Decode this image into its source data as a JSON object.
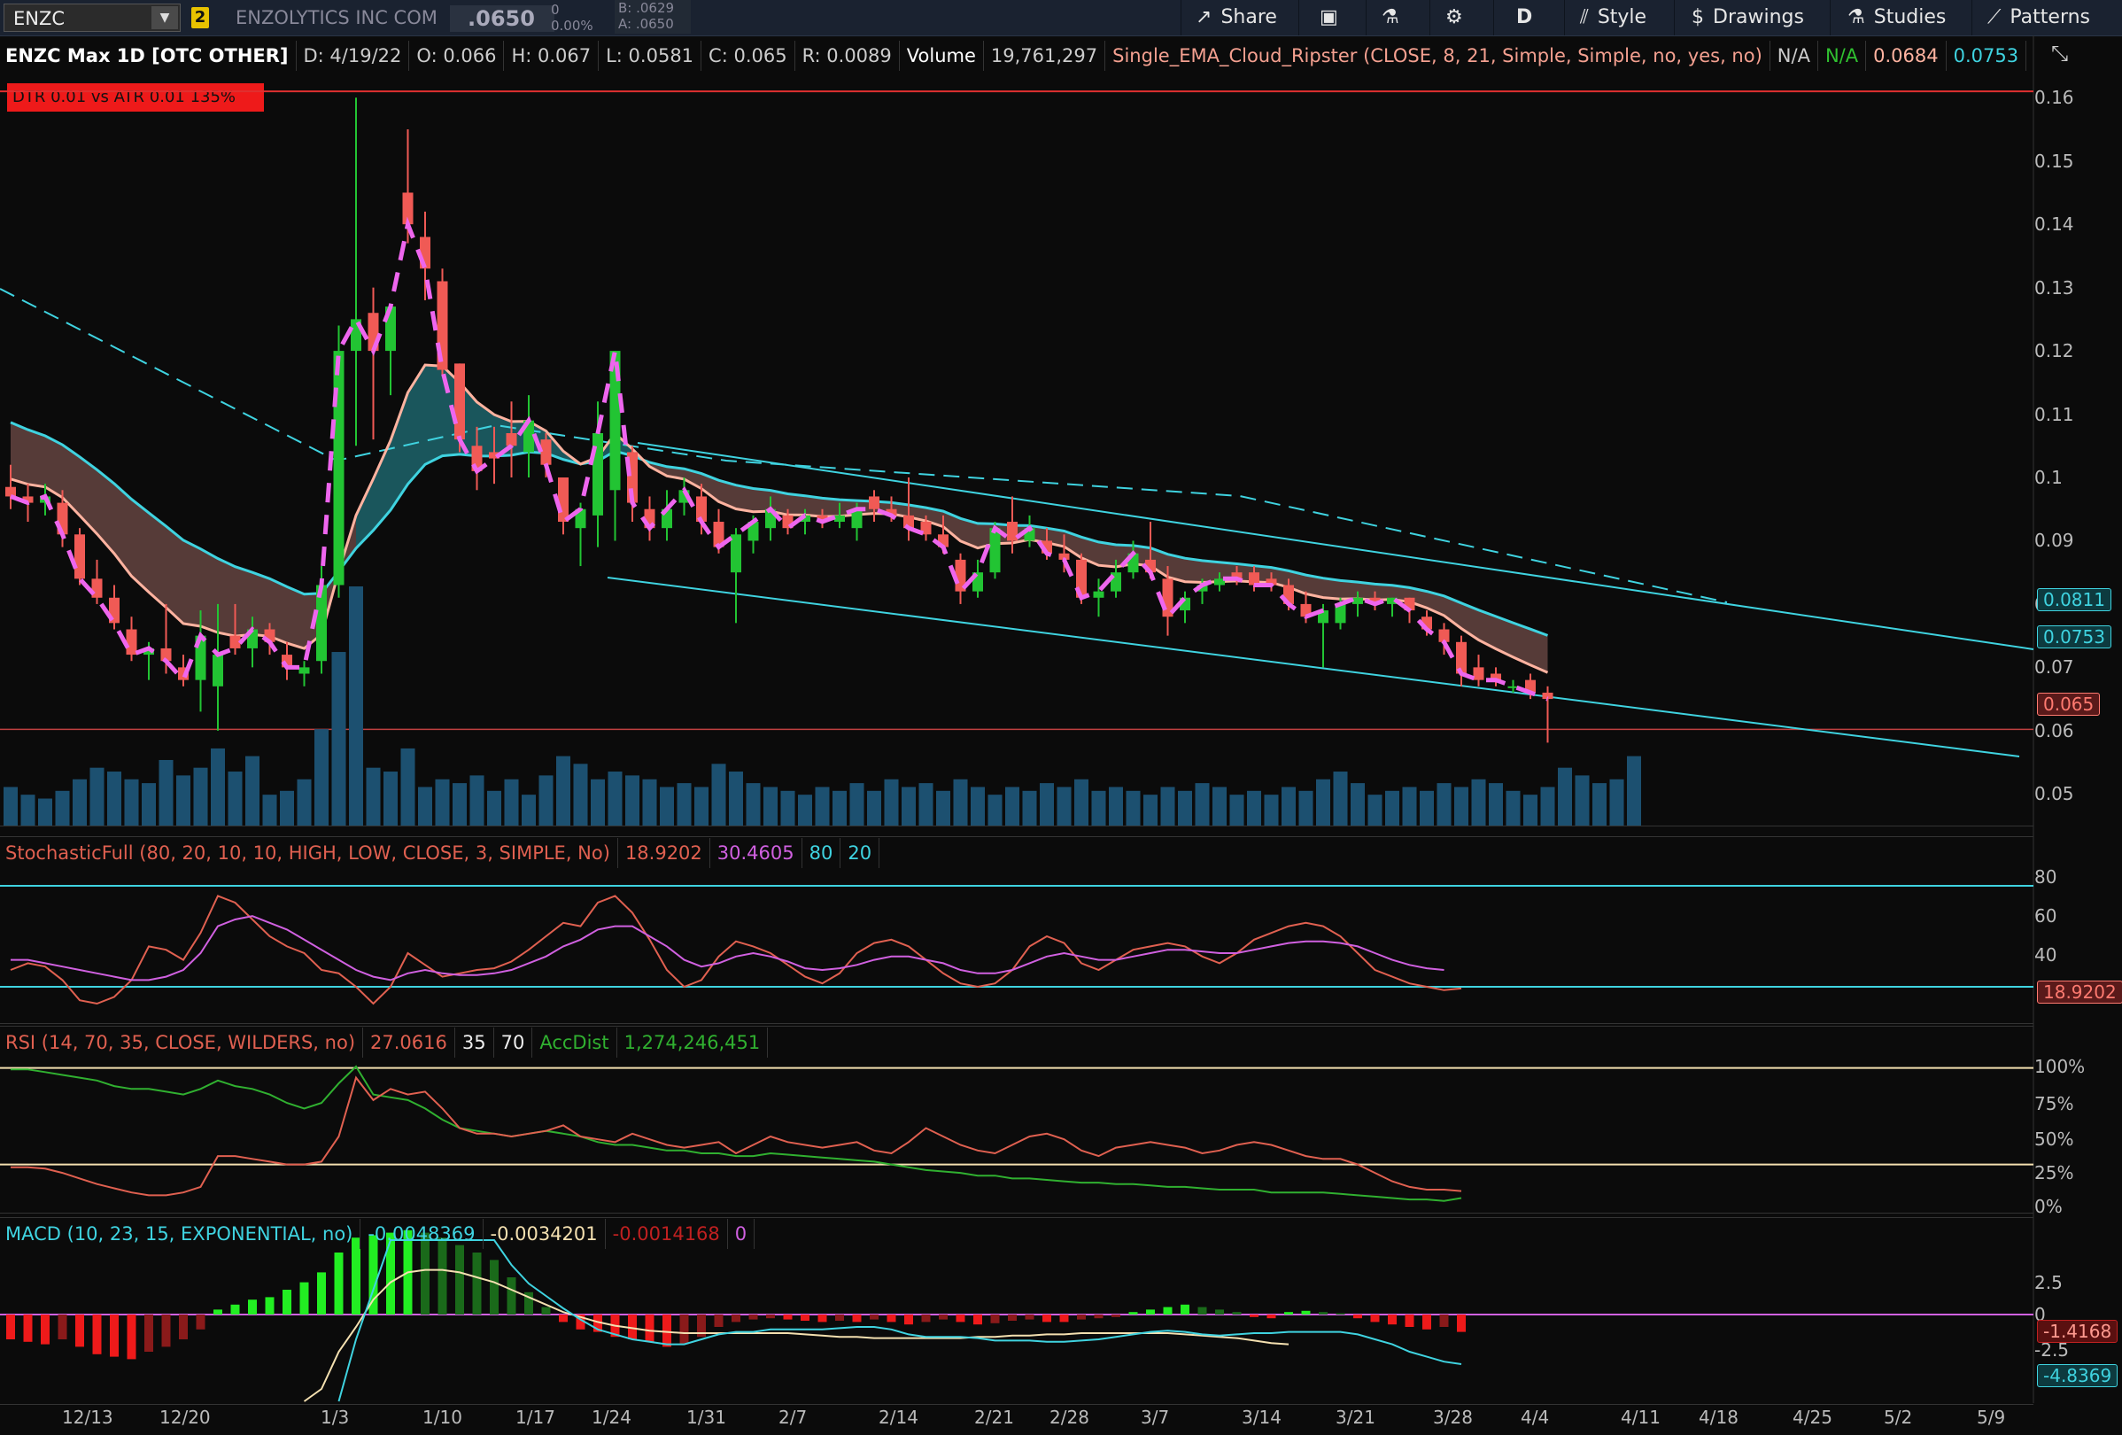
{
  "toolbar": {
    "symbol": "ENZC",
    "link_badge": "2",
    "company": "ENZOLYTICS INC COM",
    "last": ".0650",
    "net_change": "0",
    "pct_change": "0.00%",
    "bid": "B: .0629",
    "ask": "A: .0650",
    "share_label": "Share",
    "period_label": "D",
    "style_label": "Style",
    "drawings_label": "Drawings",
    "studies_label": "Studies",
    "patterns_label": "Patterns"
  },
  "price_header": {
    "title": "ENZC Max 1D [OTC OTHER]",
    "date": "D: 4/19/22",
    "open": "O: 0.066",
    "high": "H: 0.067",
    "low": "L: 0.0581",
    "close": "C: 0.065",
    "range": "R: 0.0089",
    "volume_label": "Volume",
    "volume_value": "19,761,297",
    "study": "Single_EMA_Cloud_Ripster (CLOSE, 8, 21, Simple, Simple, no, yes, no)",
    "v1": "N/A",
    "v2": "N/A",
    "v3": "0.0684",
    "v4": "0.0753",
    "dtr": "DTR 0.01 vs ATR 0.01  135%"
  },
  "price_axis": {
    "ticks": [
      "0.16",
      "0.15",
      "0.14",
      "0.13",
      "0.12",
      "0.11",
      "0.1",
      "0.09",
      "0.08",
      "0.07",
      "0.06",
      "0.05"
    ],
    "labels": {
      "ema_fast": "0.0811",
      "ema_slow": "0.0753",
      "last": "0.065"
    }
  },
  "stoch": {
    "header": "StochasticFull (80, 20, 10, 10, HIGH, LOW, CLOSE, 3, SIMPLE, No)",
    "k": "18.9202",
    "d": "30.4605",
    "ob": "80",
    "os": "20",
    "ticks": [
      "80",
      "60",
      "40"
    ],
    "last_label": "18.9202"
  },
  "rsi": {
    "header": "RSI (14, 70, 35, CLOSE, WILDERS, no)",
    "value": "27.0616",
    "os": "35",
    "ob": "70",
    "acc_label": "AccDist",
    "acc_value": "1,274,246,451",
    "ticks": [
      "100%",
      "75%",
      "50%",
      "25%",
      "0%"
    ]
  },
  "macd": {
    "header": "MACD (10, 23, 15, EXPONENTIAL, no)",
    "value": "-0.0048369",
    "avg": "-0.0034201",
    "diff": "-0.0014168",
    "zero": "0",
    "ticks": [
      "2.5",
      "0",
      "-2.5"
    ],
    "label_diff": "-1.4168",
    "label_value": "-4.8369"
  },
  "x_axis": [
    "12/13",
    "12/20",
    "1/3",
    "1/10",
    "1/17",
    "1/24",
    "1/31",
    "2/7",
    "2/14",
    "2/21",
    "2/28",
    "3/7",
    "3/14",
    "3/21",
    "3/28",
    "4/4",
    "4/11",
    "4/18",
    "4/25",
    "5/2",
    "5/9"
  ],
  "colors": {
    "up": "#22c433",
    "down": "#f05a55",
    "ema_fast": "#ffb3a0",
    "ema_slow": "#3fd3e0",
    "signal": "#ee66ee",
    "volume": "#1c5070",
    "stoch_k": "#e06050",
    "stoch_d": "#d060e0",
    "rsi": "#e06050",
    "accdist": "#30b030",
    "macd_line": "#3fd3e0",
    "macd_avg": "#f4e0b0"
  },
  "chart_data": {
    "type": "candlestick",
    "title": "ENZC Max 1D [OTC OTHER]",
    "price_range": [
      0.045,
      0.162
    ],
    "candles": [
      {
        "o": 0.0985,
        "h": 0.102,
        "l": 0.095,
        "c": 0.097
      },
      {
        "o": 0.097,
        "h": 0.099,
        "l": 0.093,
        "c": 0.096
      },
      {
        "o": 0.096,
        "h": 0.099,
        "l": 0.094,
        "c": 0.097
      },
      {
        "o": 0.096,
        "h": 0.098,
        "l": 0.089,
        "c": 0.091
      },
      {
        "o": 0.091,
        "h": 0.092,
        "l": 0.083,
        "c": 0.084
      },
      {
        "o": 0.084,
        "h": 0.087,
        "l": 0.08,
        "c": 0.081
      },
      {
        "o": 0.081,
        "h": 0.083,
        "l": 0.076,
        "c": 0.077
      },
      {
        "o": 0.076,
        "h": 0.078,
        "l": 0.071,
        "c": 0.072
      },
      {
        "o": 0.072,
        "h": 0.074,
        "l": 0.068,
        "c": 0.073
      },
      {
        "o": 0.073,
        "h": 0.08,
        "l": 0.069,
        "c": 0.071
      },
      {
        "o": 0.07,
        "h": 0.072,
        "l": 0.067,
        "c": 0.068
      },
      {
        "o": 0.068,
        "h": 0.079,
        "l": 0.063,
        "c": 0.075
      },
      {
        "o": 0.067,
        "h": 0.08,
        "l": 0.06,
        "c": 0.072
      },
      {
        "o": 0.075,
        "h": 0.08,
        "l": 0.072,
        "c": 0.073
      },
      {
        "o": 0.073,
        "h": 0.078,
        "l": 0.07,
        "c": 0.076
      },
      {
        "o": 0.076,
        "h": 0.077,
        "l": 0.072,
        "c": 0.074
      },
      {
        "o": 0.072,
        "h": 0.074,
        "l": 0.068,
        "c": 0.07
      },
      {
        "o": 0.069,
        "h": 0.071,
        "l": 0.067,
        "c": 0.07
      },
      {
        "o": 0.071,
        "h": 0.086,
        "l": 0.069,
        "c": 0.083
      },
      {
        "o": 0.083,
        "h": 0.124,
        "l": 0.081,
        "c": 0.12
      },
      {
        "o": 0.12,
        "h": 0.16,
        "l": 0.105,
        "c": 0.125
      },
      {
        "o": 0.126,
        "h": 0.13,
        "l": 0.106,
        "c": 0.12
      },
      {
        "o": 0.12,
        "h": 0.127,
        "l": 0.113,
        "c": 0.127
      },
      {
        "o": 0.145,
        "h": 0.155,
        "l": 0.137,
        "c": 0.14
      },
      {
        "o": 0.138,
        "h": 0.142,
        "l": 0.128,
        "c": 0.133
      },
      {
        "o": 0.131,
        "h": 0.133,
        "l": 0.116,
        "c": 0.117
      },
      {
        "o": 0.118,
        "h": 0.118,
        "l": 0.104,
        "c": 0.106
      },
      {
        "o": 0.105,
        "h": 0.108,
        "l": 0.098,
        "c": 0.101
      },
      {
        "o": 0.104,
        "h": 0.108,
        "l": 0.099,
        "c": 0.103
      },
      {
        "o": 0.107,
        "h": 0.112,
        "l": 0.1,
        "c": 0.105
      },
      {
        "o": 0.104,
        "h": 0.113,
        "l": 0.1,
        "c": 0.109
      },
      {
        "o": 0.106,
        "h": 0.107,
        "l": 0.1,
        "c": 0.102
      },
      {
        "o": 0.1,
        "h": 0.1,
        "l": 0.091,
        "c": 0.093
      },
      {
        "o": 0.092,
        "h": 0.096,
        "l": 0.086,
        "c": 0.095
      },
      {
        "o": 0.094,
        "h": 0.112,
        "l": 0.089,
        "c": 0.107
      },
      {
        "o": 0.098,
        "h": 0.12,
        "l": 0.09,
        "c": 0.12
      },
      {
        "o": 0.104,
        "h": 0.105,
        "l": 0.093,
        "c": 0.096
      },
      {
        "o": 0.095,
        "h": 0.097,
        "l": 0.09,
        "c": 0.092
      },
      {
        "o": 0.092,
        "h": 0.098,
        "l": 0.09,
        "c": 0.095
      },
      {
        "o": 0.096,
        "h": 0.1,
        "l": 0.094,
        "c": 0.098
      },
      {
        "o": 0.097,
        "h": 0.099,
        "l": 0.091,
        "c": 0.093
      },
      {
        "o": 0.093,
        "h": 0.095,
        "l": 0.088,
        "c": 0.089
      },
      {
        "o": 0.085,
        "h": 0.092,
        "l": 0.077,
        "c": 0.091
      },
      {
        "o": 0.09,
        "h": 0.094,
        "l": 0.088,
        "c": 0.093
      },
      {
        "o": 0.092,
        "h": 0.097,
        "l": 0.09,
        "c": 0.095
      },
      {
        "o": 0.094,
        "h": 0.095,
        "l": 0.091,
        "c": 0.092
      },
      {
        "o": 0.093,
        "h": 0.095,
        "l": 0.091,
        "c": 0.094
      },
      {
        "o": 0.094,
        "h": 0.095,
        "l": 0.092,
        "c": 0.093
      },
      {
        "o": 0.093,
        "h": 0.096,
        "l": 0.092,
        "c": 0.094
      },
      {
        "o": 0.092,
        "h": 0.096,
        "l": 0.09,
        "c": 0.095
      },
      {
        "o": 0.097,
        "h": 0.098,
        "l": 0.093,
        "c": 0.095
      },
      {
        "o": 0.095,
        "h": 0.097,
        "l": 0.093,
        "c": 0.094
      },
      {
        "o": 0.094,
        "h": 0.1,
        "l": 0.09,
        "c": 0.092
      },
      {
        "o": 0.093,
        "h": 0.094,
        "l": 0.09,
        "c": 0.091
      },
      {
        "o": 0.091,
        "h": 0.094,
        "l": 0.088,
        "c": 0.089
      },
      {
        "o": 0.087,
        "h": 0.088,
        "l": 0.08,
        "c": 0.082
      },
      {
        "o": 0.082,
        "h": 0.087,
        "l": 0.081,
        "c": 0.085
      },
      {
        "o": 0.085,
        "h": 0.093,
        "l": 0.084,
        "c": 0.092
      },
      {
        "o": 0.093,
        "h": 0.097,
        "l": 0.088,
        "c": 0.09
      },
      {
        "o": 0.09,
        "h": 0.094,
        "l": 0.089,
        "c": 0.092
      },
      {
        "o": 0.09,
        "h": 0.092,
        "l": 0.087,
        "c": 0.088
      },
      {
        "o": 0.088,
        "h": 0.091,
        "l": 0.085,
        "c": 0.087
      },
      {
        "o": 0.087,
        "h": 0.088,
        "l": 0.08,
        "c": 0.081
      },
      {
        "o": 0.081,
        "h": 0.084,
        "l": 0.078,
        "c": 0.082
      },
      {
        "o": 0.082,
        "h": 0.087,
        "l": 0.081,
        "c": 0.085
      },
      {
        "o": 0.085,
        "h": 0.09,
        "l": 0.084,
        "c": 0.088
      },
      {
        "o": 0.087,
        "h": 0.093,
        "l": 0.084,
        "c": 0.085
      },
      {
        "o": 0.084,
        "h": 0.086,
        "l": 0.075,
        "c": 0.078
      },
      {
        "o": 0.079,
        "h": 0.082,
        "l": 0.077,
        "c": 0.081
      },
      {
        "o": 0.082,
        "h": 0.084,
        "l": 0.08,
        "c": 0.083
      },
      {
        "o": 0.083,
        "h": 0.085,
        "l": 0.082,
        "c": 0.084
      },
      {
        "o": 0.085,
        "h": 0.086,
        "l": 0.083,
        "c": 0.084
      },
      {
        "o": 0.085,
        "h": 0.086,
        "l": 0.082,
        "c": 0.083
      },
      {
        "o": 0.084,
        "h": 0.085,
        "l": 0.082,
        "c": 0.083
      },
      {
        "o": 0.083,
        "h": 0.084,
        "l": 0.079,
        "c": 0.08
      },
      {
        "o": 0.08,
        "h": 0.082,
        "l": 0.077,
        "c": 0.078
      },
      {
        "o": 0.077,
        "h": 0.08,
        "l": 0.07,
        "c": 0.079
      },
      {
        "o": 0.077,
        "h": 0.081,
        "l": 0.076,
        "c": 0.08
      },
      {
        "o": 0.08,
        "h": 0.082,
        "l": 0.078,
        "c": 0.081
      },
      {
        "o": 0.081,
        "h": 0.082,
        "l": 0.079,
        "c": 0.08
      },
      {
        "o": 0.08,
        "h": 0.081,
        "l": 0.078,
        "c": 0.081
      },
      {
        "o": 0.081,
        "h": 0.081,
        "l": 0.077,
        "c": 0.079
      },
      {
        "o": 0.078,
        "h": 0.079,
        "l": 0.075,
        "c": 0.076
      },
      {
        "o": 0.076,
        "h": 0.077,
        "l": 0.072,
        "c": 0.074
      },
      {
        "o": 0.074,
        "h": 0.075,
        "l": 0.067,
        "c": 0.069
      },
      {
        "o": 0.07,
        "h": 0.072,
        "l": 0.067,
        "c": 0.068
      },
      {
        "o": 0.069,
        "h": 0.07,
        "l": 0.067,
        "c": 0.068
      },
      {
        "o": 0.067,
        "h": 0.068,
        "l": 0.066,
        "c": 0.067
      },
      {
        "o": 0.068,
        "h": 0.069,
        "l": 0.065,
        "c": 0.066
      },
      {
        "o": 0.066,
        "h": 0.067,
        "l": 0.0581,
        "c": 0.065
      }
    ],
    "volume": [
      10,
      8,
      7,
      9,
      12,
      15,
      14,
      12,
      11,
      17,
      13,
      15,
      20,
      14,
      18,
      8,
      9,
      12,
      25,
      45,
      62,
      15,
      14,
      20,
      10,
      12,
      11,
      13,
      9,
      12,
      8,
      13,
      18,
      16,
      12,
      14,
      13,
      12,
      10,
      11,
      10,
      16,
      14,
      11,
      10,
      9,
      8,
      10,
      9,
      11,
      9,
      12,
      10,
      11,
      9,
      12,
      10,
      8,
      10,
      9,
      11,
      10,
      12,
      9,
      10,
      9,
      8,
      10,
      9,
      11,
      10,
      8,
      9,
      8,
      10,
      9,
      12,
      14,
      11,
      8,
      9,
      10,
      9,
      11,
      10,
      12,
      11,
      9,
      8,
      10,
      15,
      13,
      11,
      12,
      18
    ]
  }
}
